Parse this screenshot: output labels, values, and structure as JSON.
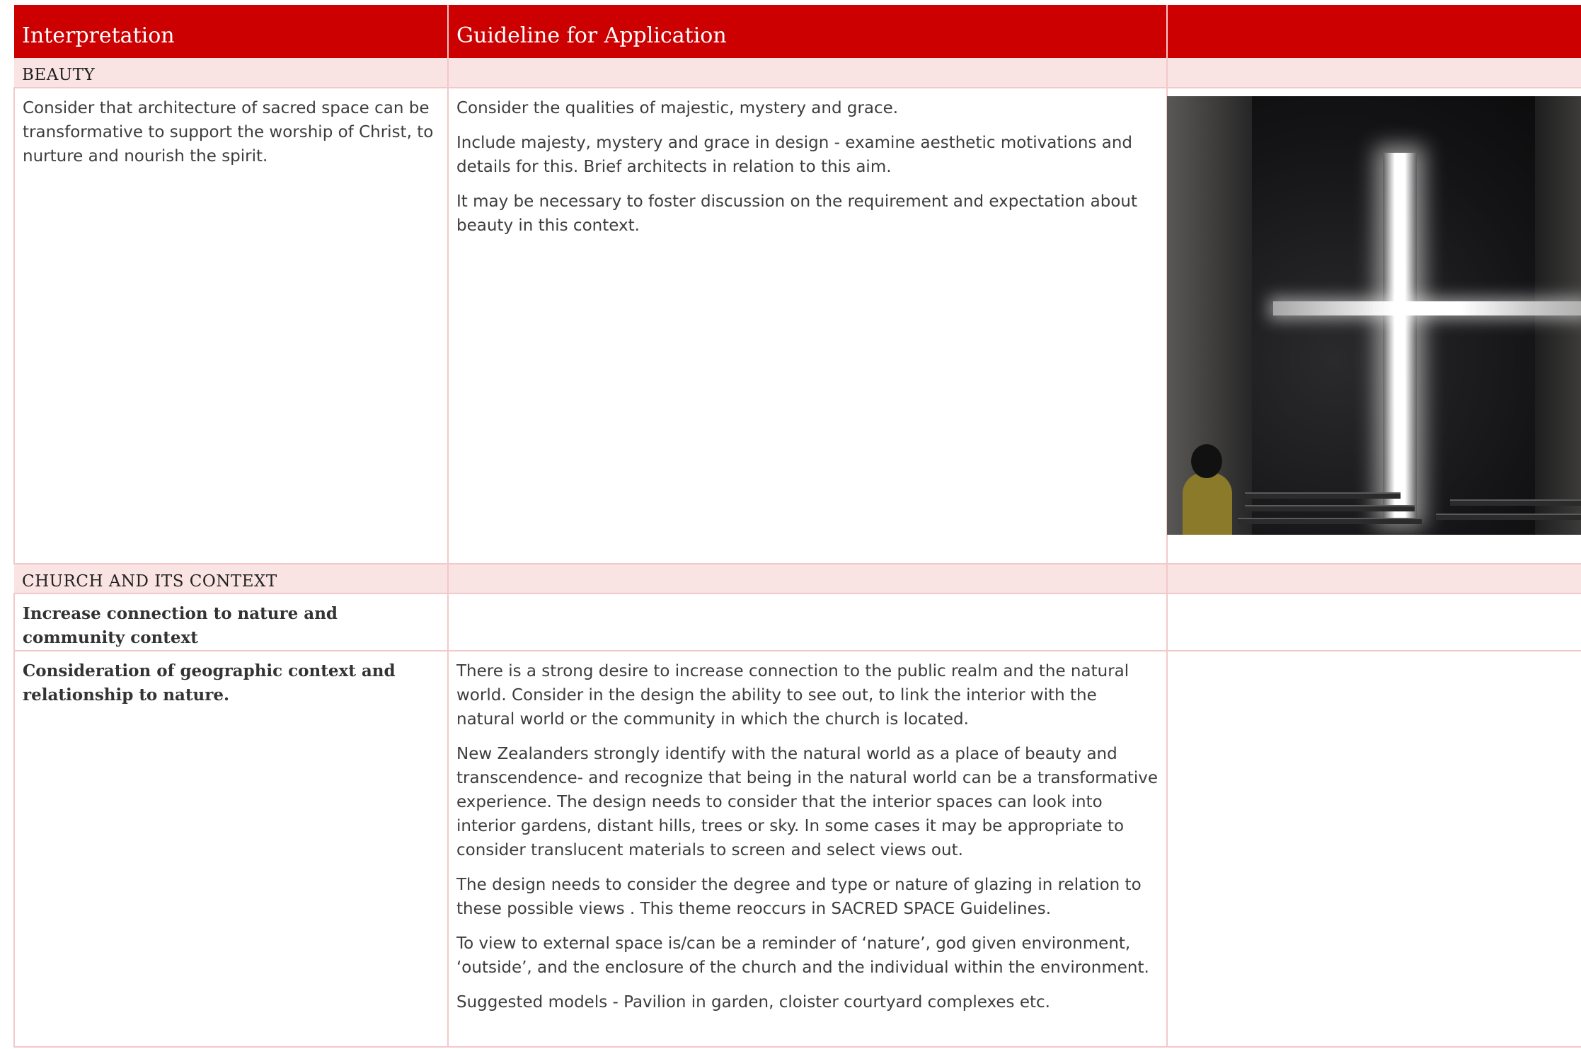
{
  "header": {
    "col1": "Interpretation",
    "col2": "Guideline for Application",
    "col3": ""
  },
  "sections": {
    "beauty": {
      "title": "BEAUTY"
    },
    "church": {
      "title": "CHURCH AND ITS CONTEXT"
    }
  },
  "rows": {
    "beauty_interp": "Consider that architecture of sacred space can be transformative to support the worship of Christ, to nurture and nourish the spirit.",
    "beauty_guides": [
      "Consider the qualities of majestic, mystery and grace.",
      "Include majesty, mystery and grace in design - examine aesthetic motivations and details for this.  Brief architects in relation to this aim.",
      "It may be necessary to foster discussion on the requirement and expectation about beauty in this context."
    ],
    "connection_interp": "Increase connection to nature and community context",
    "geo_interp": "Consideration of geographic context and relationship to nature.",
    "geo_guides": [
      "There is a strong desire to increase connection to the public realm and the natural world. Consider in the design the ability to see out, to link the interior with the natural world or the community in which the church is located.",
      "New Zealanders strongly identify with the natural world as a place of beauty and transcendence- and recognize that being in the natural world can be a transformative experience. The design needs to consider that the interior spaces can look into interior gardens, distant hills, trees or sky. In some cases it may be appropriate to consider translucent materials to screen and select views out.",
      "The design needs to consider the degree and type or nature of glazing in relation to these possible views . This theme reoccurs in SACRED SPACE Guidelines.",
      "To view to external space is/can be a reminder of ‘nature’, god given environment, ‘outside’, and the enclosure of the church and the individual within the environment.",
      "Suggested models - Pavilion in garden, cloister courtyard complexes etc."
    ]
  },
  "image": {
    "subject": "church-of-light-interior-photo"
  },
  "colors": {
    "header_bg": "#cc0000",
    "section_bg": "#fae3e3",
    "rule": "#f2c9c9"
  }
}
